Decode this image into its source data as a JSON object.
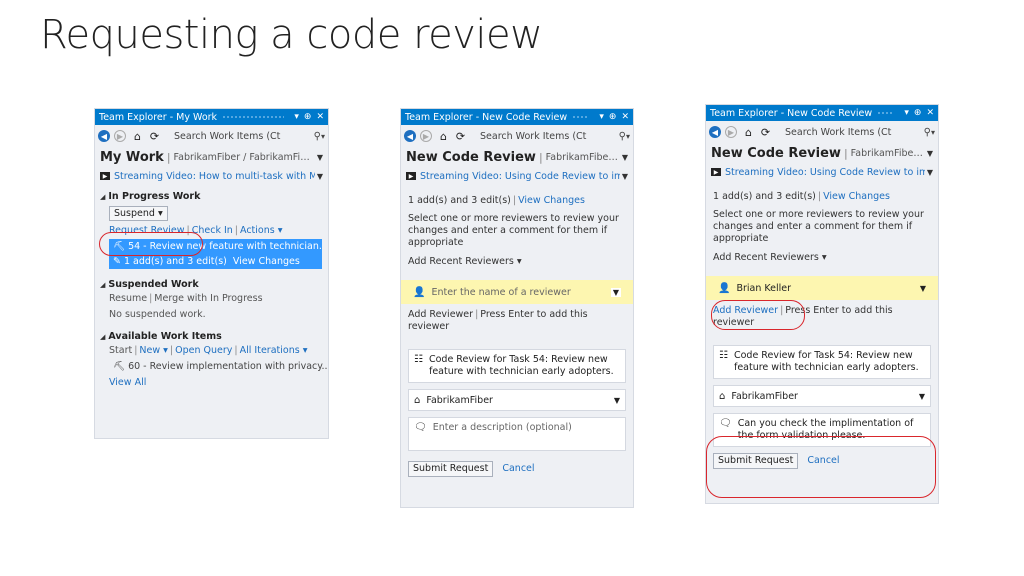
{
  "slide": {
    "title": "Requesting a code review"
  },
  "titlebar_icons": {
    "dropdown": "▾",
    "pin": "⊕",
    "close": "✕"
  },
  "search_placeholder": "Search Work Items (Ct",
  "panel1": {
    "title": "Team Explorer - My Work",
    "header": "My Work",
    "subheader": "FabrikamFiber / FabrikamFiber...",
    "video": "Streaming Video: How to multi-task with M",
    "in_progress": "In Progress Work",
    "suspend": "Suspend",
    "request_review": "Request Review",
    "check_in": "Check In",
    "actions": "Actions",
    "selected_item": "54 - Review new feature with technician...",
    "changes": "1 add(s) and 3 edit(s)",
    "view_changes": "View Changes",
    "suspended": "Suspended Work",
    "resume": "Resume",
    "merge": "Merge with In Progress",
    "no_suspended": "No suspended work.",
    "available": "Available Work Items",
    "start": "Start",
    "new": "New",
    "open_query": "Open Query",
    "all_iterations": "All Iterations",
    "available_item": "60 - Review implementation with privacy...",
    "view_all": "View All"
  },
  "panel2": {
    "title": "Team Explorer - New Code Review",
    "header": "New Code Review",
    "subheader": "FabrikamFiber / Fabr...",
    "video": "Streaming Video: Using Code Review to imp",
    "changes": "1 add(s) and 3 edit(s)",
    "view_changes": "View Changes",
    "instructions": "Select one or more reviewers to review your changes and enter a comment for them if appropriate",
    "add_recent": "Add Recent Reviewers",
    "reviewer_placeholder": "Enter the name of a reviewer",
    "add_reviewer": "Add Reviewer",
    "press_enter": "Press Enter to add this reviewer",
    "review_title": "Code Review for Task 54: Review new feature with technician early adopters.",
    "team_project": "FabrikamFiber",
    "description_placeholder": "Enter a description (optional)",
    "submit": "Submit Request",
    "cancel": "Cancel"
  },
  "panel3": {
    "title": "Team Explorer - New Code Review",
    "header": "New Code Review",
    "subheader": "FabrikamFiber / Fabr...",
    "video": "Streaming Video: Using Code Review to imp",
    "changes": "1 add(s) and 3 edit(s)",
    "view_changes": "View Changes",
    "instructions": "Select one or more reviewers to review your changes and enter a comment for them if appropriate",
    "add_recent": "Add Recent Reviewers",
    "reviewer": "Brian Keller",
    "add_reviewer": "Add Reviewer",
    "press_enter": "Press Enter to add this reviewer",
    "review_title": "Code Review for Task 54: Review new feature with technician early adopters.",
    "team_project": "FabrikamFiber",
    "description": "Can you check the implimentation of the form validation please.",
    "submit": "Submit Request",
    "cancel": "Cancel"
  },
  "colors": {
    "titlebar": "#007acc",
    "selection": "#3399ff",
    "link": "#1e6fc0",
    "highlight": "#fdf6b0",
    "annotation": "#d9262c"
  }
}
